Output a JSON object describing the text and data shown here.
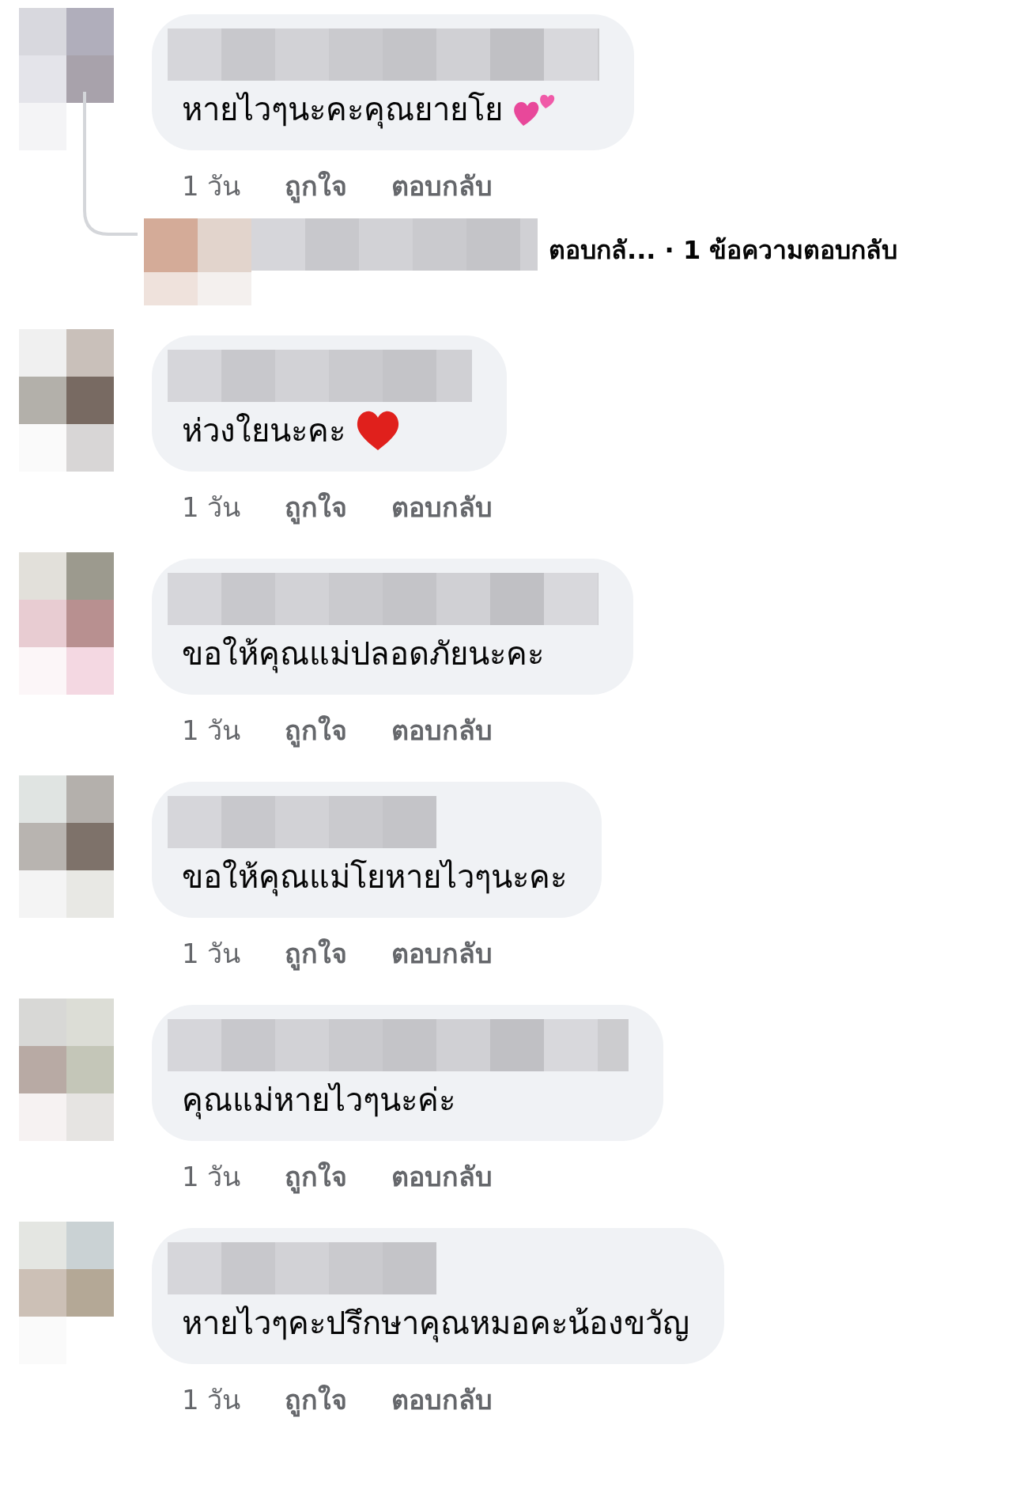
{
  "comments": [
    {
      "text": "หายไวๆนะคะคุณยายโย",
      "kind": "hearts",
      "time": "1 วัน",
      "like": "ถูกใจ",
      "reply": "ตอบกลับ",
      "replies_preview": "ตอบกลั... · 1 ข้อความตอบกลับ"
    },
    {
      "text": "ห่วงใยนะคะ",
      "kind": "heart",
      "time": "1 วัน",
      "like": "ถูกใจ",
      "reply": "ตอบกลับ"
    },
    {
      "text": "ขอให้คุณแม่ปลอดภัยนะคะ",
      "time": "1 วัน",
      "like": "ถูกใจ",
      "reply": "ตอบกลับ"
    },
    {
      "text": "ขอให้คุณแม่โยหายไวๆนะคะ",
      "time": "1 วัน",
      "like": "ถูกใจ",
      "reply": "ตอบกลับ"
    },
    {
      "text": "คุณแม่หายไวๆนะค่ะ",
      "time": "1 วัน",
      "like": "ถูกใจ",
      "reply": "ตอบกลับ"
    },
    {
      "text": "หายไวๆคะปรึกษาคุณหมอคะน้องขวัญ",
      "time": "1 วัน",
      "like": "ถูกใจ",
      "reply": "ตอบกลับ"
    }
  ]
}
